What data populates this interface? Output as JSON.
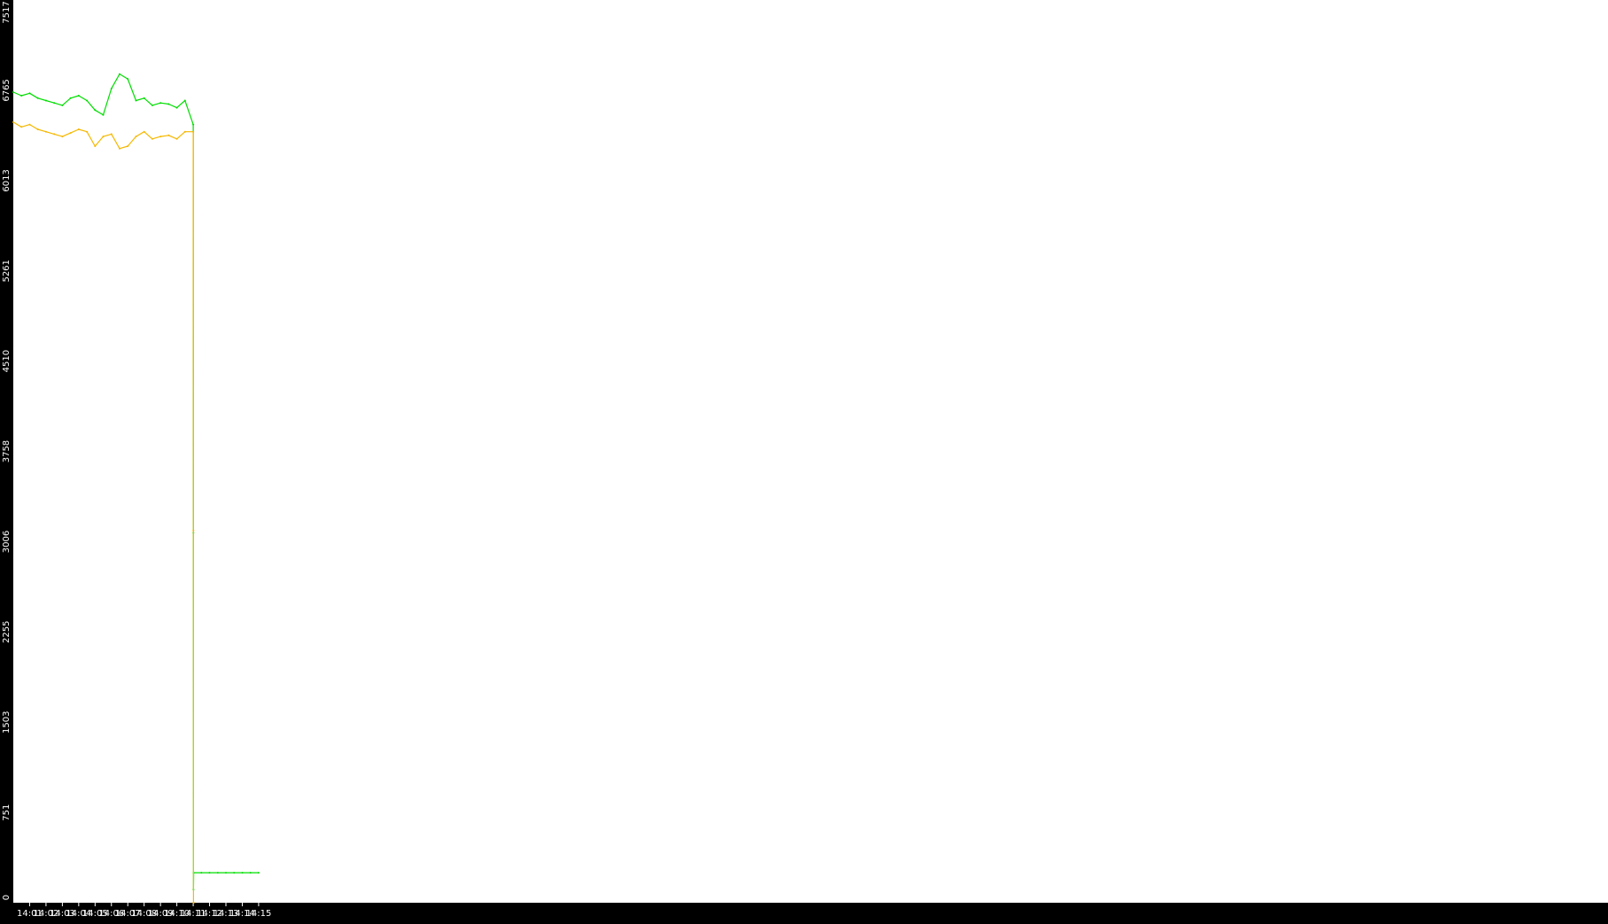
{
  "chart_data": {
    "type": "line",
    "title": "",
    "xlabel": "",
    "ylabel": "",
    "background_color": "#000000",
    "plot_background_color": "#ffffff",
    "axis_text_color": "#ffffff",
    "xlim_minutes": [
      14.0,
      14.975
    ],
    "ylim": [
      0,
      7517
    ],
    "y_ticks": [
      {
        "value": 0,
        "label": "0"
      },
      {
        "value": 751,
        "label": "751"
      },
      {
        "value": 1503,
        "label": "1503"
      },
      {
        "value": 2255,
        "label": "2255"
      },
      {
        "value": 3006,
        "label": "3006"
      },
      {
        "value": 3758,
        "label": "3758"
      },
      {
        "value": 4510,
        "label": "4510"
      },
      {
        "value": 5261,
        "label": "5261"
      },
      {
        "value": 6013,
        "label": "6013"
      },
      {
        "value": 6765,
        "label": "6765"
      },
      {
        "value": 7517,
        "label": "7517"
      }
    ],
    "x_ticks": [
      {
        "value": 14.01,
        "label": "14:01"
      },
      {
        "value": 14.02,
        "label": "14:02"
      },
      {
        "value": 14.03,
        "label": "14:03"
      },
      {
        "value": 14.04,
        "label": "14:04"
      },
      {
        "value": 14.05,
        "label": "14:05"
      },
      {
        "value": 14.06,
        "label": "14:06"
      },
      {
        "value": 14.07,
        "label": "14:07"
      },
      {
        "value": 14.08,
        "label": "14:08"
      },
      {
        "value": 14.09,
        "label": "14:09"
      },
      {
        "value": 14.1,
        "label": "14:10"
      },
      {
        "value": 14.11,
        "label": "14:11"
      },
      {
        "value": 14.12,
        "label": "14:12"
      },
      {
        "value": 14.13,
        "label": "14:13"
      },
      {
        "value": 14.14,
        "label": "14:14"
      },
      {
        "value": 14.15,
        "label": "14:15"
      }
    ],
    "x_minutes": [
      14.0,
      14.005,
      14.01,
      14.015,
      14.02,
      14.025,
      14.03,
      14.035,
      14.04,
      14.045,
      14.05,
      14.055,
      14.06,
      14.065,
      14.07,
      14.075,
      14.08,
      14.085,
      14.09,
      14.095,
      14.1,
      14.105,
      14.11,
      14.1101,
      14.1102,
      14.1103,
      14.115,
      14.12,
      14.125,
      14.13,
      14.135,
      14.14,
      14.145,
      14.15
    ],
    "series": [
      {
        "color": "#00dd00",
        "values": [
          6750,
          6720,
          6740,
          6700,
          6680,
          6660,
          6640,
          6700,
          6720,
          6680,
          6600,
          6560,
          6780,
          6900,
          6860,
          6680,
          6700,
          6640,
          6660,
          6650,
          6620,
          6680,
          6480,
          3080,
          110,
          250,
          250,
          250,
          250,
          250,
          250,
          250,
          250,
          250
        ]
      },
      {
        "color": "#f5b800",
        "values": [
          6500,
          6460,
          6480,
          6440,
          6420,
          6400,
          6380,
          6410,
          6440,
          6420,
          6300,
          6380,
          6400,
          6280,
          6300,
          6380,
          6420,
          6360,
          6380,
          6390,
          6360,
          6420,
          6420,
          3100,
          0,
          0,
          null,
          null,
          null,
          null,
          null,
          null,
          null,
          null
        ]
      }
    ]
  }
}
